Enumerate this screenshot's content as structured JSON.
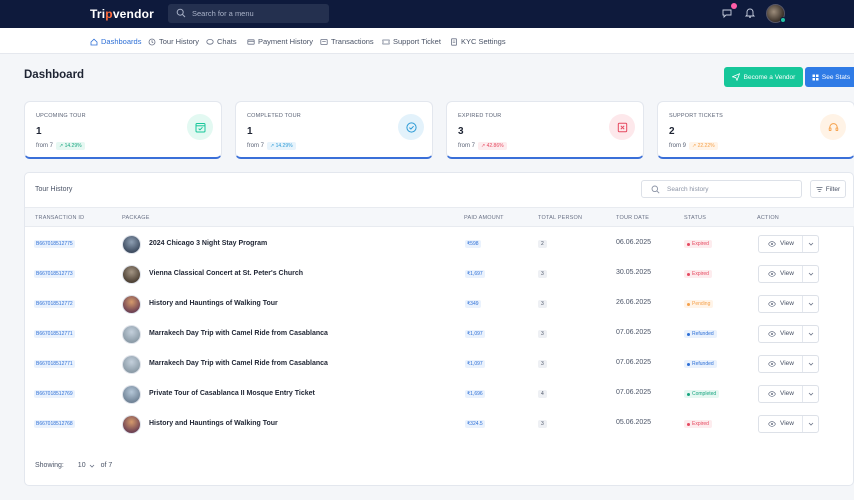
{
  "header": {
    "logo_pre": "Tri",
    "logo_accent": "p",
    "logo_post": "vendor",
    "search_placeholder": "Search for a menu"
  },
  "nav": [
    {
      "label": "Dashboards",
      "icon": "home-icon"
    },
    {
      "label": "Tour History",
      "icon": "clock-icon"
    },
    {
      "label": "Chats",
      "icon": "chat-icon"
    },
    {
      "label": "Payment History",
      "icon": "card-icon"
    },
    {
      "label": "Transactions",
      "icon": "transactions-icon"
    },
    {
      "label": "Support Ticket",
      "icon": "ticket-icon"
    },
    {
      "label": "KYC Settings",
      "icon": "document-icon"
    }
  ],
  "page": {
    "title": "Dashboard",
    "become_vendor": "Become a Vendor",
    "see_stats": "See Stats"
  },
  "stats": [
    {
      "label": "UPCOMING TOUR",
      "value": "1",
      "from": "from 7",
      "pct": "14.29%",
      "color": "#16c79a",
      "icon": "calendar-check-icon"
    },
    {
      "label": "COMPLETED TOUR",
      "value": "1",
      "from": "from 7",
      "pct": "14.29%",
      "color": "#2d9bd6",
      "icon": "check-circle-icon"
    },
    {
      "label": "EXPIRED TOUR",
      "value": "3",
      "from": "from 7",
      "pct": "42.86%",
      "color": "#e5485f",
      "icon": "x-square-icon"
    },
    {
      "label": "SUPPORT TICKETS",
      "value": "2",
      "from": "from 9",
      "pct": "22.22%",
      "color": "#f5a04a",
      "icon": "headset-icon"
    }
  ],
  "table": {
    "title": "Tour History",
    "search_placeholder": "Search history",
    "filter_label": "Filter",
    "columns": {
      "txid": "TRANSACTION ID",
      "package": "PACKAGE",
      "paid": "PAID AMOUNT",
      "persons": "TOTAL PERSON",
      "date": "TOUR DATE",
      "status": "STATUS",
      "action": "ACTION"
    },
    "view_label": "View",
    "rows": [
      {
        "txid": "B667018512775",
        "package": "2024 Chicago 3 Night Stay Program",
        "paid": "₹598",
        "persons": "2",
        "date": "06.06.2025",
        "status": "Expired"
      },
      {
        "txid": "B667018512773",
        "package": "Vienna Classical Concert at St. Peter's Church",
        "paid": "₹1,697",
        "persons": "3",
        "date": "30.05.2025",
        "status": "Expired"
      },
      {
        "txid": "B667018512772",
        "package": "History and Hauntings of Walking Tour",
        "paid": "₹349",
        "persons": "3",
        "date": "26.06.2025",
        "status": "Pending"
      },
      {
        "txid": "B667018512771",
        "package": "Marrakech Day Trip with Camel Ride from Casablanca",
        "paid": "₹1,097",
        "persons": "3",
        "date": "07.06.2025",
        "status": "Refunded"
      },
      {
        "txid": "B667018512771",
        "package": "Marrakech Day Trip with Camel Ride from Casablanca",
        "paid": "₹1,097",
        "persons": "3",
        "date": "07.06.2025",
        "status": "Refunded"
      },
      {
        "txid": "B667018512769",
        "package": "Private Tour of Casablanca II Mosque Entry Ticket",
        "paid": "₹1,696",
        "persons": "4",
        "date": "07.06.2025",
        "status": "Completed"
      },
      {
        "txid": "B667018512768",
        "package": "History and Hauntings of Walking Tour",
        "paid": "₹324.5",
        "persons": "3",
        "date": "05.06.2025",
        "status": "Expired"
      }
    ],
    "status_colors": {
      "Expired": {
        "fg": "#e5485f",
        "bg": "#fdecee"
      },
      "Pending": {
        "fg": "#f5a04a",
        "bg": "#fff4e8"
      },
      "Refunded": {
        "fg": "#2d6fd6",
        "bg": "#eaf2fd"
      },
      "Completed": {
        "fg": "#16a47f",
        "bg": "#e6f8f2"
      }
    }
  },
  "footer": {
    "showing_label": "Showing:",
    "page_size": "10",
    "of_label": "of 7"
  }
}
